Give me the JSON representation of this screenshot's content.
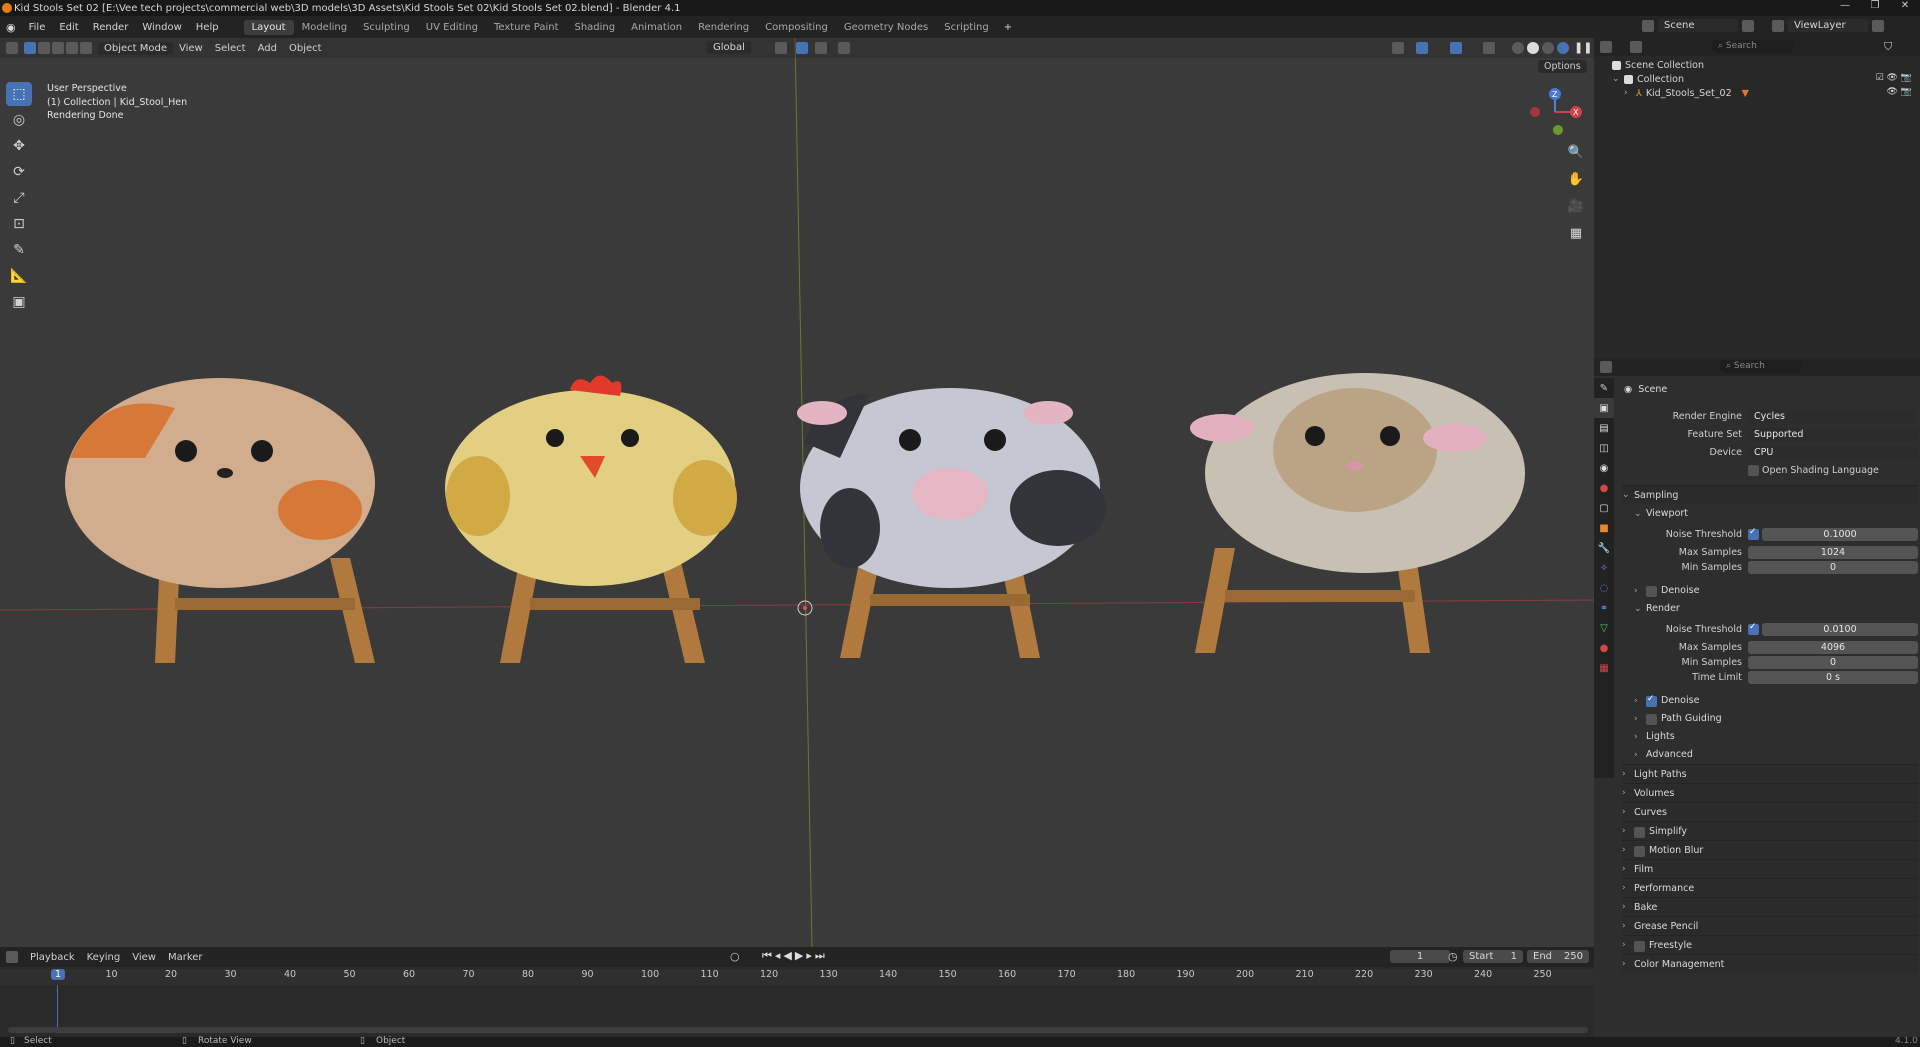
{
  "window": {
    "title": "Kid Stools Set 02 [E:\\Vee tech projects\\commercial web\\3D models\\3D Assets\\Kid Stools Set 02\\Kid Stools Set 02.blend] - Blender 4.1"
  },
  "menu": [
    "File",
    "Edit",
    "Render",
    "Window",
    "Help"
  ],
  "workspaces": [
    "Layout",
    "Modeling",
    "Sculpting",
    "UV Editing",
    "Texture Paint",
    "Shading",
    "Animation",
    "Rendering",
    "Compositing",
    "Geometry Nodes",
    "Scripting"
  ],
  "scene_selector": {
    "scene": "Scene",
    "view_layer": "ViewLayer"
  },
  "viewport": {
    "mode": "Object Mode",
    "menu": [
      "View",
      "Select",
      "Add",
      "Object"
    ],
    "transform_orientation": "Global",
    "options": "Options",
    "info": [
      "User Perspective",
      "(1) Collection | Kid_Stool_Hen",
      "Rendering Done"
    ],
    "gizmo": {
      "z": "Z",
      "x": "X"
    }
  },
  "outliner": {
    "search_placeholder": "Search",
    "items": [
      {
        "label": "Scene Collection",
        "level": 0
      },
      {
        "label": "Collection",
        "level": 1
      },
      {
        "label": "Kid_Stools_Set_02",
        "level": 2
      }
    ]
  },
  "properties": {
    "search_placeholder": "Search",
    "context": "Scene",
    "render_engine_label": "Render Engine",
    "render_engine": "Cycles",
    "feature_set_label": "Feature Set",
    "feature_set": "Supported",
    "device_label": "Device",
    "device": "CPU",
    "osl": "Open Shading Language",
    "sampling": "Sampling",
    "viewport": "Viewport",
    "noise_threshold_label": "Noise Threshold",
    "vp_noise_threshold": "0.1000",
    "max_samples_label": "Max Samples",
    "vp_max_samples": "1024",
    "min_samples_label": "Min Samples",
    "vp_min_samples": "0",
    "denoise": "Denoise",
    "render": "Render",
    "r_noise_threshold": "0.0100",
    "r_max_samples": "4096",
    "r_min_samples": "0",
    "time_limit_label": "Time Limit",
    "r_time_limit": "0 s",
    "path_guiding": "Path Guiding",
    "lights": "Lights",
    "advanced": "Advanced",
    "panels": [
      "Light Paths",
      "Volumes",
      "Curves",
      "Simplify",
      "Motion Blur",
      "Film",
      "Performance",
      "Bake",
      "Grease Pencil",
      "Freestyle",
      "Color Management"
    ]
  },
  "timeline": {
    "menu": [
      "Playback",
      "Keying",
      "View",
      "Marker"
    ],
    "current_frame": "1",
    "start_label": "Start",
    "start": "1",
    "end_label": "End",
    "end": "250",
    "ticks": [
      "1",
      "10",
      "20",
      "30",
      "40",
      "50",
      "60",
      "70",
      "80",
      "90",
      "100",
      "110",
      "120",
      "130",
      "140",
      "150",
      "160",
      "170",
      "180",
      "190",
      "200",
      "210",
      "220",
      "230",
      "240",
      "250"
    ]
  },
  "status": {
    "select": "Select",
    "rotate": "Rotate View",
    "object": "Object",
    "version": "4.1.0"
  },
  "icons": [
    "blender-logo-icon",
    "select-box-icon",
    "cursor-icon",
    "move-icon",
    "rotate-icon",
    "scale-icon",
    "transform-icon",
    "annotate-icon",
    "measure-icon",
    "add-cube-icon",
    "zoom-icon",
    "hand-pan-icon",
    "camera-view-icon",
    "grid-ortho-icon",
    "eye-icon",
    "camera-icon",
    "filter-icon",
    "funnel-icon",
    "render-tab-icon",
    "output-tab-icon",
    "view-layer-tab-icon",
    "scene-tab-icon",
    "world-tab-icon",
    "collection-tab-icon",
    "object-tab-icon",
    "modifier-tab-icon",
    "particles-tab-icon",
    "physics-tab-icon",
    "constraints-tab-icon",
    "data-tab-icon",
    "material-tab-icon",
    "texture-tab-icon"
  ],
  "colors": {
    "accent": "#4772b3",
    "viewport_bg": "#3a3a3a",
    "axis_x": "#cf3f4c",
    "axis_y": "#7b9a2f"
  }
}
